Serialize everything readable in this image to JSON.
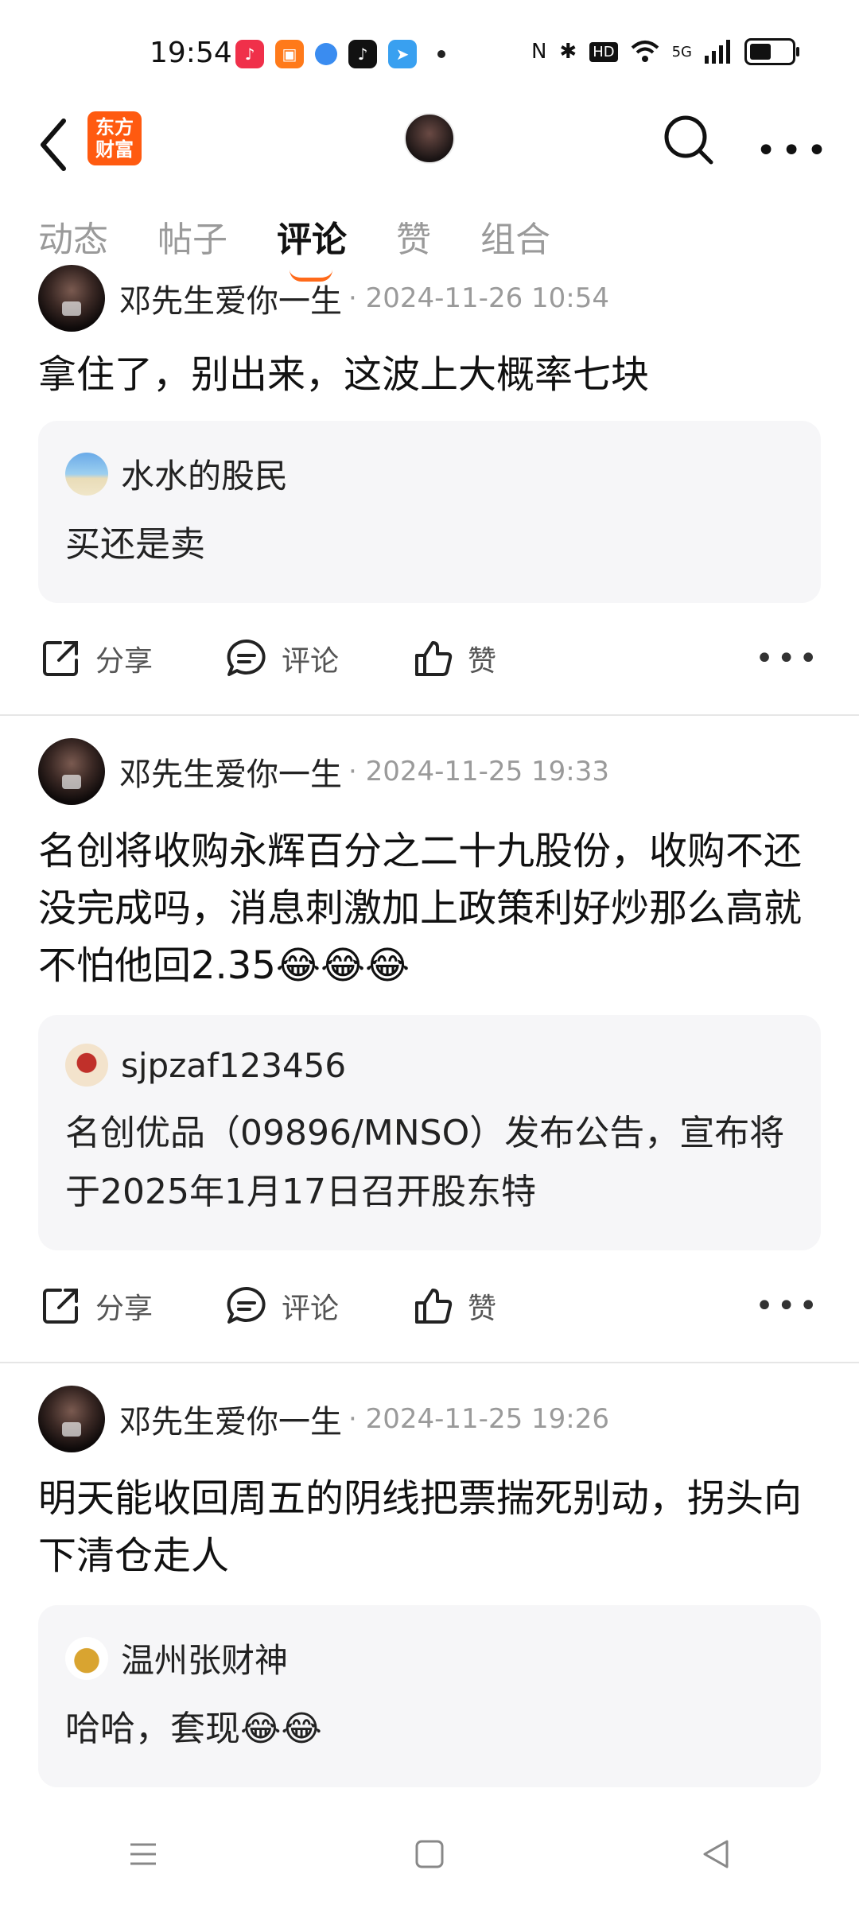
{
  "status_bar": {
    "time": "19:54",
    "network": "5G",
    "hd": "HD"
  },
  "header": {
    "logo_text": "东方财富",
    "logo_color": "#ff5a10"
  },
  "tabs": [
    {
      "label": "动态",
      "active": false
    },
    {
      "label": "帖子",
      "active": false
    },
    {
      "label": "评论",
      "active": true
    },
    {
      "label": "赞",
      "active": false
    },
    {
      "label": "组合",
      "active": false
    }
  ],
  "posts": [
    {
      "author": "邓先生爱你一生",
      "time": "· 2024-11-26 10:54",
      "text": "拿住了，别出来，这波上大概率七块",
      "quote": {
        "user": "水水的股民",
        "text": "买还是卖"
      }
    },
    {
      "author": "邓先生爱你一生",
      "time": "· 2024-11-25 19:33",
      "text": "名创将收购永辉百分之二十九股份，收购不还没完成吗，消息刺激加上政策利好炒那么高就不怕他回2.35😂😂😂",
      "quote": {
        "user": "sjpzaf123456",
        "text": "名创优品（09896/MNSO）发布公告，宣布将于2025年1月17日召开股东特"
      }
    },
    {
      "author": "邓先生爱你一生",
      "time": "· 2024-11-25 19:26",
      "text": "明天能收回周五的阴线把票揣死别动，拐头向下清仓走人",
      "quote": {
        "user": "温州张财神",
        "text": "哈哈，套现😂😂"
      }
    }
  ],
  "actions": {
    "share": "分享",
    "comment": "评论",
    "like": "赞"
  },
  "accent_color": "#ff6a1a"
}
